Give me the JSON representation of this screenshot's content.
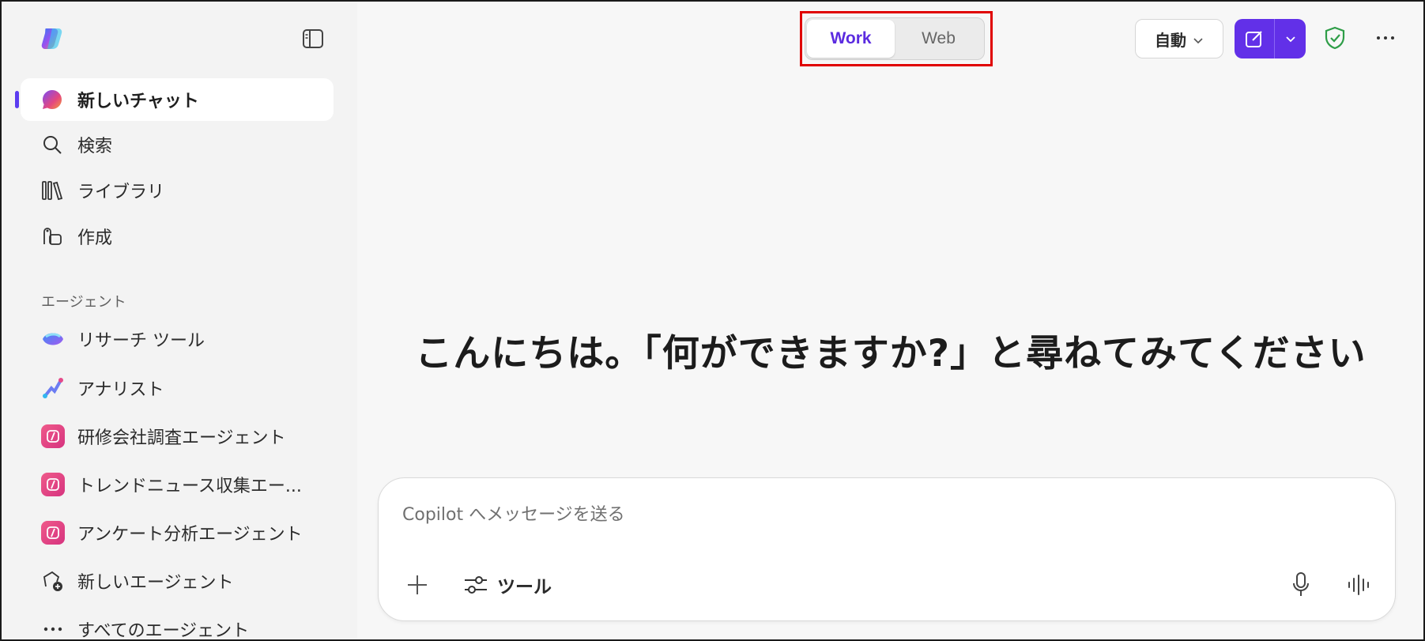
{
  "sidebar": {
    "nav": [
      {
        "label": "新しいチャット",
        "icon": "new-chat-icon"
      },
      {
        "label": "検索",
        "icon": "search-icon"
      },
      {
        "label": "ライブラリ",
        "icon": "library-icon"
      },
      {
        "label": "作成",
        "icon": "create-icon"
      }
    ],
    "agents_section_label": "エージェント",
    "agents": [
      {
        "label": "リサーチ ツール",
        "icon": "researcher-icon"
      },
      {
        "label": "アナリスト",
        "icon": "analyst-icon"
      },
      {
        "label": "研修会社調査エージェント",
        "icon": "agent-icon"
      },
      {
        "label": "トレンドニュース収集エー...",
        "icon": "agent-icon"
      },
      {
        "label": "アンケート分析エージェント",
        "icon": "agent-icon"
      },
      {
        "label": "新しいエージェント",
        "icon": "new-agent-icon"
      },
      {
        "label": "すべてのエージェント",
        "icon": "more-icon"
      }
    ]
  },
  "header": {
    "mode_options": [
      "Work",
      "Web"
    ],
    "selected_mode": "Work",
    "model_select": "自動",
    "colors": {
      "accent": "#6230e8",
      "highlight_box": "#e00000",
      "shield": "#2e9d47"
    }
  },
  "main": {
    "greeting": "こんにちは。「何ができますか?」と尋ねてみてください"
  },
  "composer": {
    "placeholder": "Copilot へメッセージを送る",
    "tools_label": "ツール"
  }
}
